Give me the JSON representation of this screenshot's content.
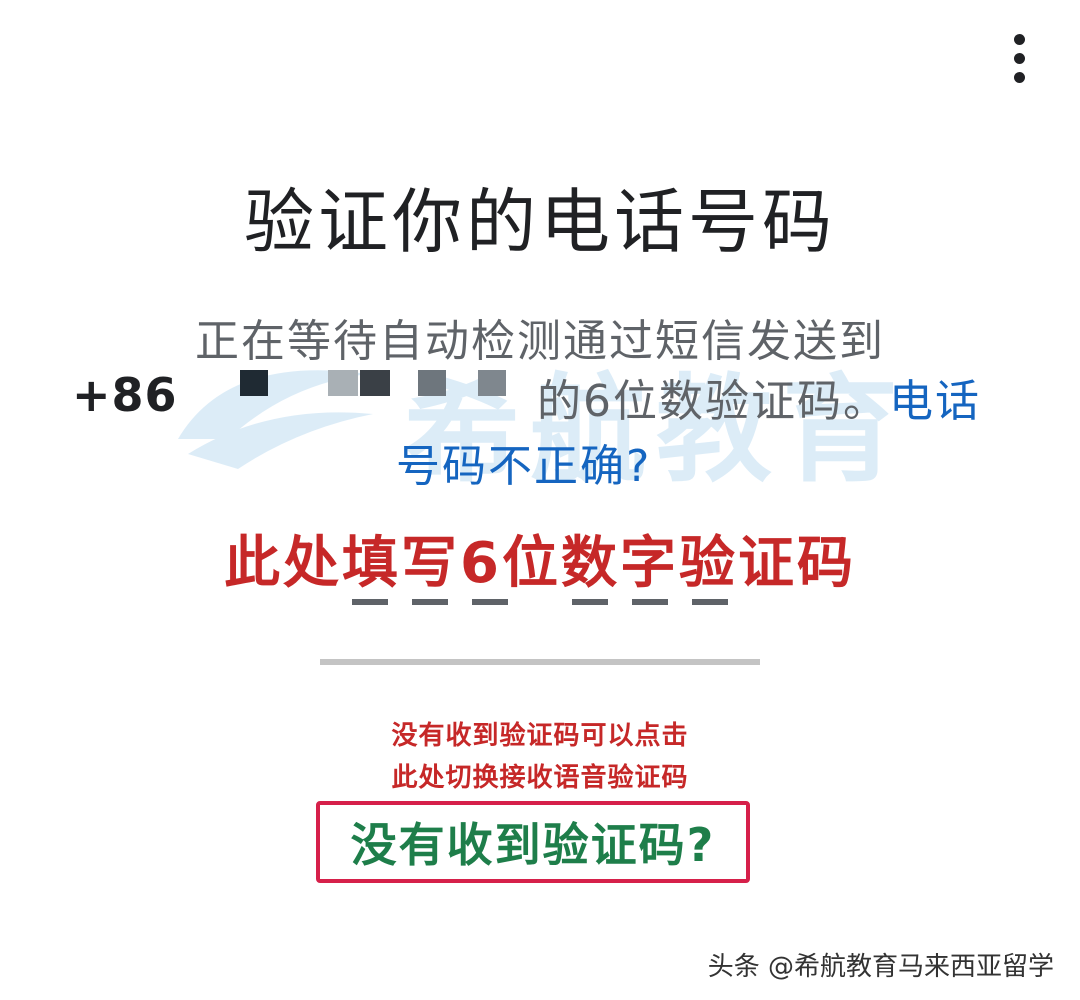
{
  "header": {
    "menu_icon": "more-vert-icon"
  },
  "watermark": {
    "text": "希航教育",
    "color": "#2b8fd3"
  },
  "title": "验证你的电话号码",
  "description": {
    "line1": "正在等待自动检测通过短信发送到",
    "country_code": "+86",
    "after_number": "的6位数验证码。",
    "wrong_number_link_part1": "电话",
    "wrong_number_link_part2": "号码不正确?"
  },
  "annotations": {
    "fill_hint": "此处填写6位数字验证码",
    "voice_hint_line1": "没有收到验证码可以点击",
    "voice_hint_line2": "此处切换接收语音验证码"
  },
  "code_input": {
    "digits": 6
  },
  "resend": {
    "label": "没有收到验证码?"
  },
  "footer": {
    "attribution": "头条 @希航教育马来西亚留学"
  },
  "colors": {
    "link": "#1565c0",
    "annotation": "#c62828",
    "resend_text": "#1e7e4a",
    "resend_border": "#d6204a"
  }
}
